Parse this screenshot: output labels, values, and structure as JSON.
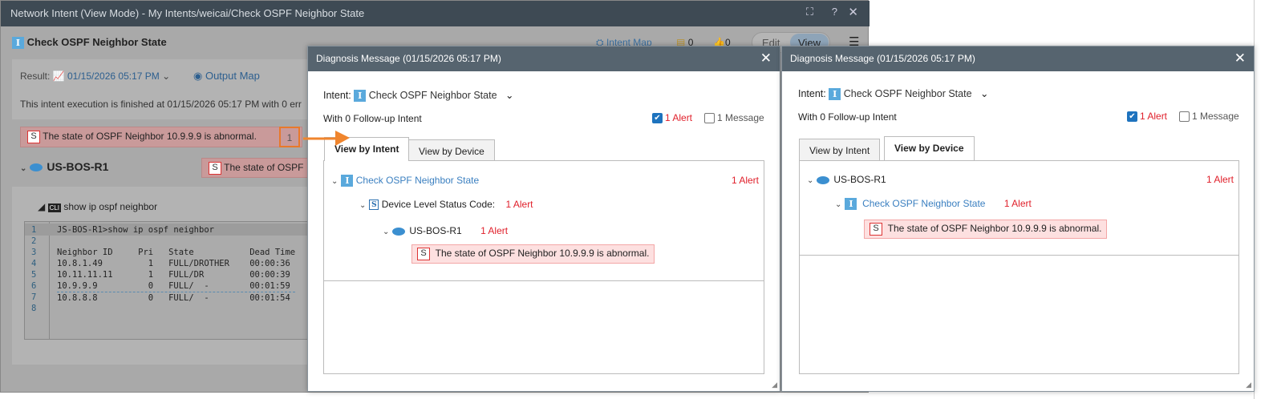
{
  "main_window": {
    "title": "Network Intent (View Mode) - My Intents/weicai/Check OSPF Neighbor State",
    "intent_name": "Check OSPF Neighbor State",
    "intent_map_label": "Intent Map",
    "notes_count": "0",
    "likes_count": "0",
    "edit_label": "Edit",
    "view_label": "View",
    "result_label": "Result:",
    "result_time": "01/15/2026 05:17 PM",
    "output_map_label": "Output Map",
    "execution_message": "This intent execution is finished at 01/15/2026 05:17 PM with 0 err",
    "alert_message": "The state of OSPF Neighbor 10.9.9.9 is abnormal.",
    "alert_count": "1",
    "device_name": "US-BOS-R1",
    "device_alert_message": "The state of OSPF",
    "cli_command": "show ip ospf neighbor",
    "code_lines": [
      "JS-BOS-R1>show ip ospf neighbor",
      "",
      "Neighbor ID     Pri   State           Dead Time",
      "10.8.1.49         1   FULL/DROTHER    00:00:36",
      "10.11.11.11       1   FULL/DR         00:00:39",
      "10.9.9.9          0   FULL/  -        00:01:59",
      "10.8.8.8          0   FULL/  -        00:01:54",
      ""
    ]
  },
  "dialogs": [
    {
      "title": "Diagnosis Message",
      "time": "(01/15/2026 05:17 PM)",
      "intent_label": "Intent:",
      "intent_name": "Check OSPF Neighbor State",
      "followup": "With 0 Follow-up Intent",
      "alert_filter": "1 Alert",
      "message_filter": "1 Message",
      "tab_intent": "View by Intent",
      "tab_device": "View by Device",
      "tree": {
        "intent": "Check OSPF Neighbor State",
        "intent_alert": "1 Alert",
        "status_code": "Device Level Status Code:",
        "status_alert": "1 Alert",
        "device": "US-BOS-R1",
        "device_alert": "1 Alert",
        "message": "The state of OSPF Neighbor 10.9.9.9 is abnormal."
      }
    },
    {
      "title": "Diagnosis Message",
      "time": "(01/15/2026 05:17 PM)",
      "intent_label": "Intent:",
      "intent_name": "Check OSPF Neighbor State",
      "followup": "With 0 Follow-up Intent",
      "alert_filter": "1 Alert",
      "message_filter": "1 Message",
      "tab_intent": "View by Intent",
      "tab_device": "View by Device",
      "tree": {
        "device": "US-BOS-R1",
        "device_alert": "1 Alert",
        "intent": "Check OSPF Neighbor State",
        "intent_alert": "1 Alert",
        "message": "The state of OSPF Neighbor 10.9.9.9 is abnormal."
      }
    }
  ]
}
